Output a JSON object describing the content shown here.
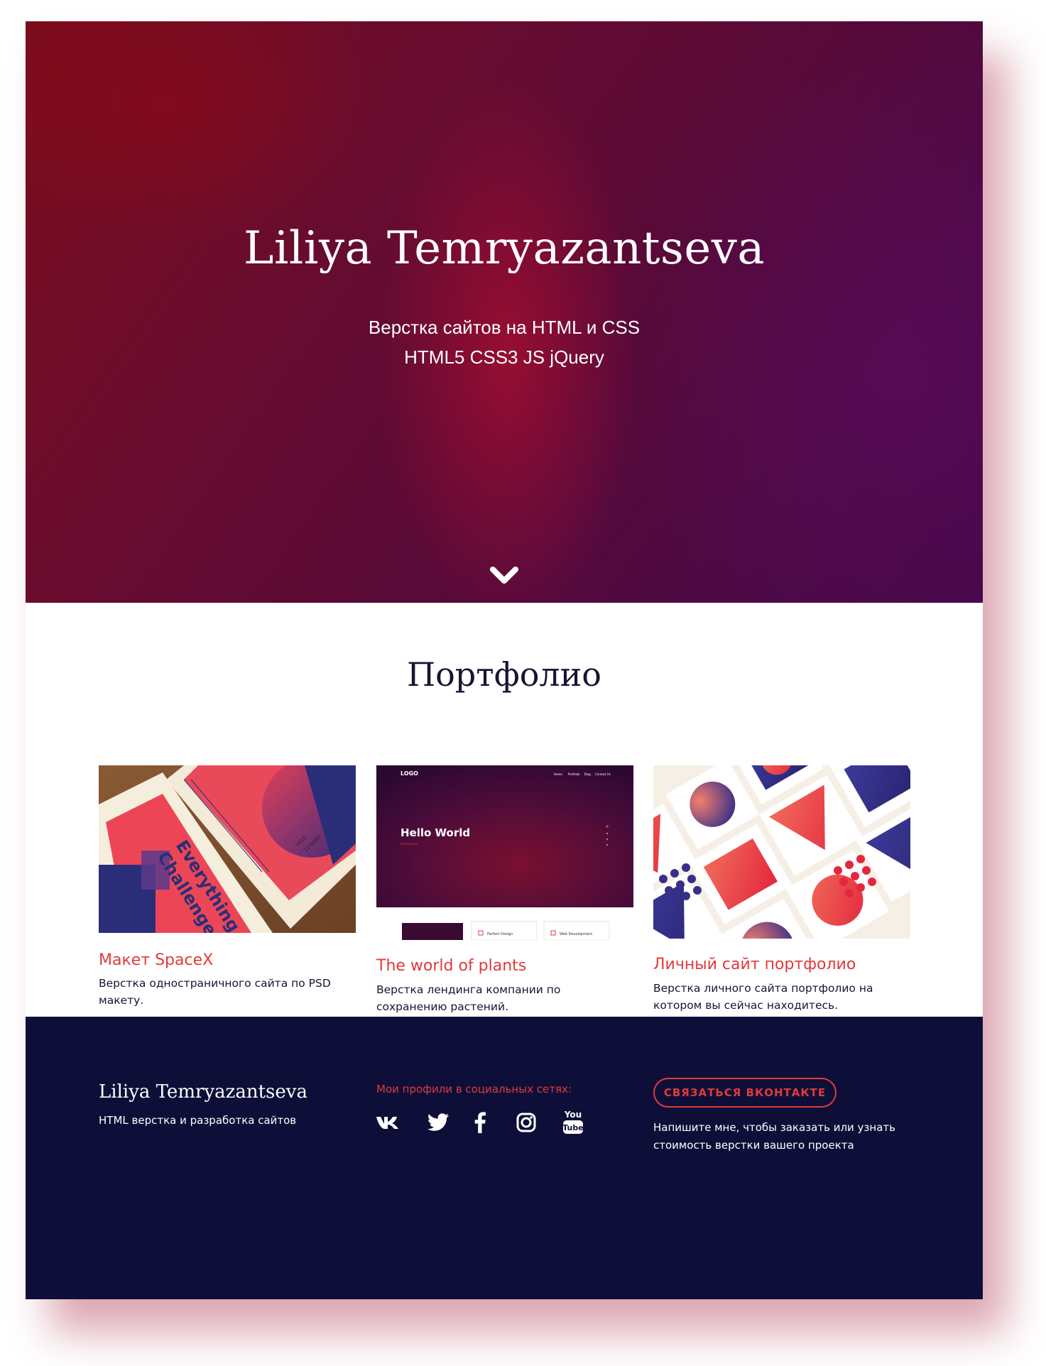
{
  "hero": {
    "title": "Liliya Temryazantseva",
    "subtitle_line1": "Верстка сайтов на HTML и CSS",
    "subtitle_line2": "HTML5 CSS3 JS jQuery",
    "scroll_icon": "chevron-down-icon"
  },
  "portfolio": {
    "title": "Портфолио",
    "items": [
      {
        "title": "Макет SpaceX",
        "description": "Верстка одностраничного сайта по PSD макету.",
        "image_texts": {
          "line1": "Challenge",
          "line2": "Everything",
          "small1": "1916",
          "small2": "12 folds!",
          "small3": "be bau",
          "small4": "nce"
        }
      },
      {
        "title": "The world of plants",
        "description": "Верстка лендинга компании по сохранению растений.",
        "image_texts": {
          "logo": "LOGO",
          "nav": [
            "Home",
            "Portfolio",
            "Blog",
            "Contact Us"
          ],
          "hero": "Hello World",
          "hero_small": "Hello to you",
          "feature1": "Perfect Design",
          "feature2": "Web Development"
        }
      },
      {
        "title": "Личный сайт портфолио",
        "description": "Верстка личного сайта портфолио на котором вы сейчас находитесь."
      }
    ]
  },
  "footer": {
    "name": "Liliya Temryazantseva",
    "tagline": "HTML верстка и разработка сайтов",
    "social_heading": "Мои профили в социальных сетях:",
    "social": [
      {
        "icon": "vk-icon"
      },
      {
        "icon": "twitter-icon"
      },
      {
        "icon": "facebook-icon"
      },
      {
        "icon": "instagram-icon"
      },
      {
        "icon": "youtube-icon",
        "label": "You",
        "label2": "Tube"
      }
    ],
    "contact_button": "СВЯЗАТЬСЯ ВКОНТАКТЕ",
    "contact_note_line1": "Напишите мне, чтобы заказать или узнать",
    "contact_note_line2": "стоимость верстки вашего проекта"
  },
  "colors": {
    "accent": "#e03a3a",
    "footer_bg": "#0e0f38",
    "hero_dark": "#5a0a36",
    "text_dark": "#1b1330"
  }
}
